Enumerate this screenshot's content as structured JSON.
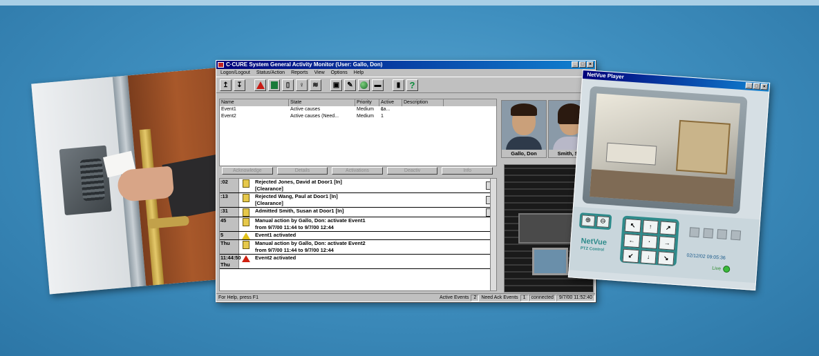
{
  "ccure": {
    "title": "C·CURE System General Activity Monitor (User: Gallo, Don)",
    "menu": [
      "Logon/Logout",
      "Status/Action",
      "Reports",
      "View",
      "Options",
      "Help"
    ],
    "events": {
      "headers": [
        "Name",
        "State",
        "Priority",
        "Active ca...",
        "Description"
      ],
      "rows": [
        {
          "name": "Event1",
          "state": "Active causes",
          "priority": "Medium",
          "active": "1",
          "desc": ""
        },
        {
          "name": "Event2",
          "state": "Active causes (Need...",
          "priority": "Medium",
          "active": "1",
          "desc": ""
        }
      ]
    },
    "event_buttons": [
      "Acknowledge",
      "Details",
      "Activations",
      "Deactiv",
      "Info"
    ],
    "journal": [
      {
        "time": ":02",
        "line1": "Rejected Jones, David at Door1 [In]",
        "line2": "[Clearance]"
      },
      {
        "time": ":13",
        "line1": "Rejected Wang, Paul at Door1 [In]",
        "line2": "[Clearance]"
      },
      {
        "time": ":31",
        "line1": "Admitted Smith, Susan at Door1 [In]",
        "line2": ""
      },
      {
        "time": "45",
        "line1": "Manual action by Gallo, Don: activate Event1",
        "line2": "from 9/7/00 11:44  to  9/7/00 12:44"
      },
      {
        "time": "5",
        "line1": "Event1 activated",
        "line2": ""
      },
      {
        "time": "Thu",
        "line1": "Manual action by Gallo, Don: activate Event2",
        "line2": "from 9/7/00 11:44  to  9/7/00 12:44"
      },
      {
        "time": "11:44:50",
        "line1": "Event2 activated",
        "line2": "Thu"
      }
    ],
    "status": {
      "help": "For Help, press F1",
      "active_events_label": "Active Events",
      "active_events_value": "2",
      "need_ack_label": "Need Ack Events",
      "need_ack_value": "1",
      "connection": "connected",
      "datetime": "9/7/00 11:52:40"
    },
    "photos": [
      "Gallo, Don",
      "Smith, Sus"
    ]
  },
  "netvue": {
    "title": "NetVue Player",
    "logo": "NetVue",
    "logo_sub": "PTZ Control",
    "date": "02/12/02 09:05:36",
    "live": "Live"
  }
}
